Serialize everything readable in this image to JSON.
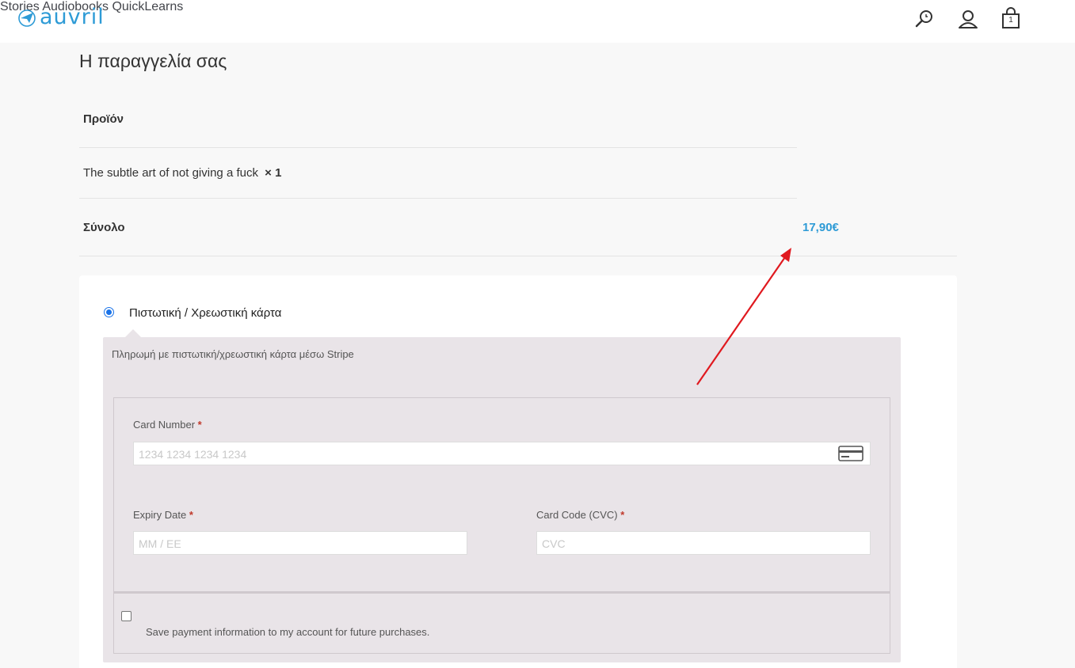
{
  "header": {
    "logo_text": "auvril",
    "nav": [
      "Stories",
      "Audiobooks",
      "QuickLearns"
    ],
    "icons": [
      "search-icon",
      "account-icon",
      "cart-icon"
    ],
    "cart_count": "1"
  },
  "order": {
    "title": "Η παραγγελία σας",
    "product_header": "Προϊόν",
    "product_name": "The subtle art of not giving a fuck",
    "product_qty": "× 1",
    "total_label": "Σύνολο",
    "total_value": "17,90€"
  },
  "payment": {
    "method_label": "Πιστωτική / Χρεωστική κάρτα",
    "description": "Πληρωμή με πιστωτική/χρεωστική κάρτα μέσω Stripe",
    "card_number_label": "Card Number",
    "card_number_placeholder": "1234 1234 1234 1234",
    "expiry_label": "Expiry Date",
    "expiry_placeholder": "MM / ΕΕ",
    "cvc_label": "Card Code (CVC)",
    "cvc_placeholder": "CVC",
    "required_mark": "*",
    "save_label": "Save payment information to my account for future purchases."
  },
  "colors": {
    "accent": "#2e9bd6",
    "panel": "#e9e4e8",
    "annotation_arrow": "#e0191f"
  }
}
